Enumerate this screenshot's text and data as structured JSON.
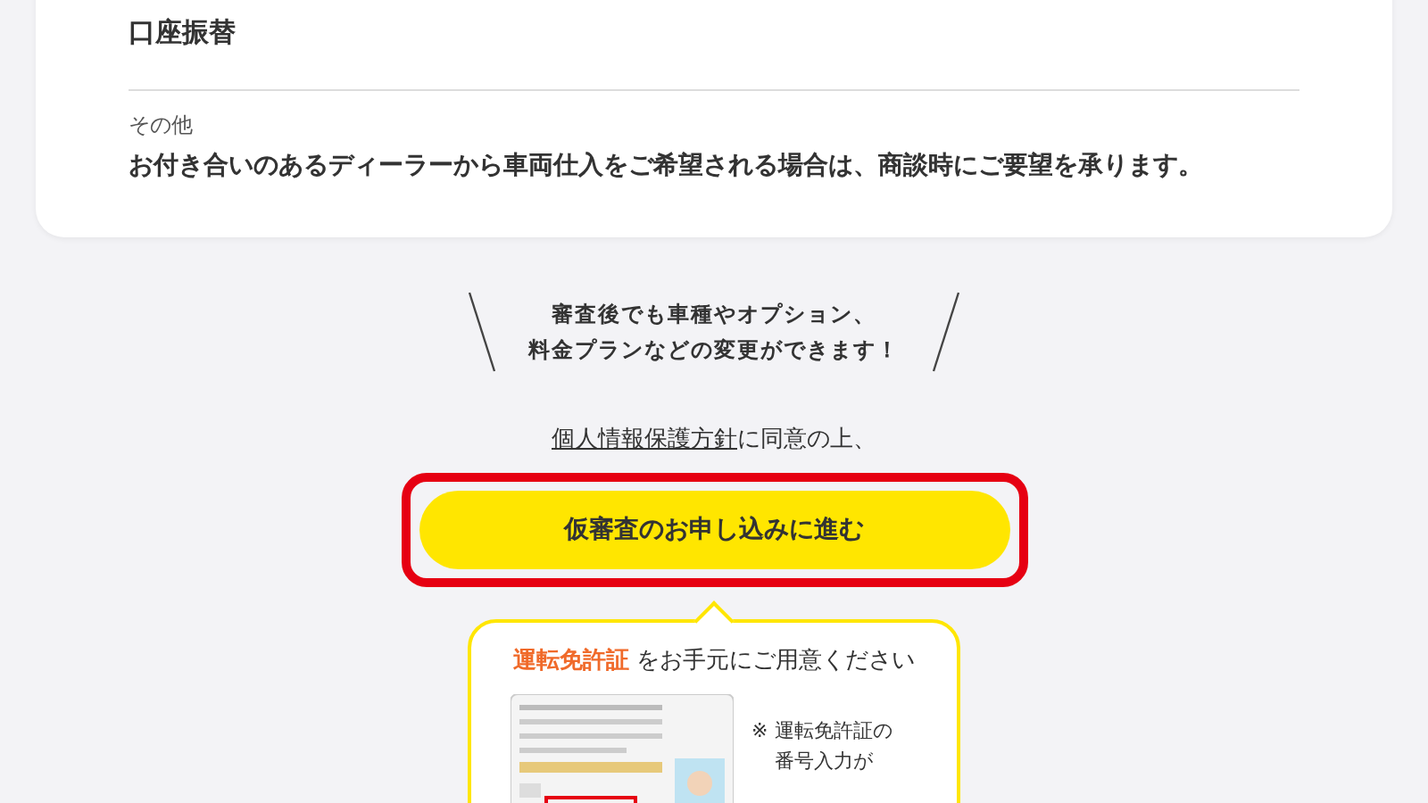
{
  "info_card": {
    "items": [
      {
        "value": "口座振替"
      },
      {
        "label": "その他",
        "value": "お付き合いのあるディーラーから車両仕入をご希望される場合は、商談時にご要望を承ります。"
      }
    ]
  },
  "callout": {
    "lines": [
      "審査後でも車種やオプション、",
      "料金プランなどの変更ができます！"
    ]
  },
  "consent": {
    "link": "個人情報保護方針",
    "text": "に同意の上、"
  },
  "apply_button": {
    "label": "仮審査のお申し込みに進む"
  },
  "license_tip": {
    "highlight": "運転免許証",
    "title": " をお手元にご用意ください",
    "note_mark": "※",
    "note_lines": [
      "運転免許証の",
      "番号入力が"
    ]
  }
}
